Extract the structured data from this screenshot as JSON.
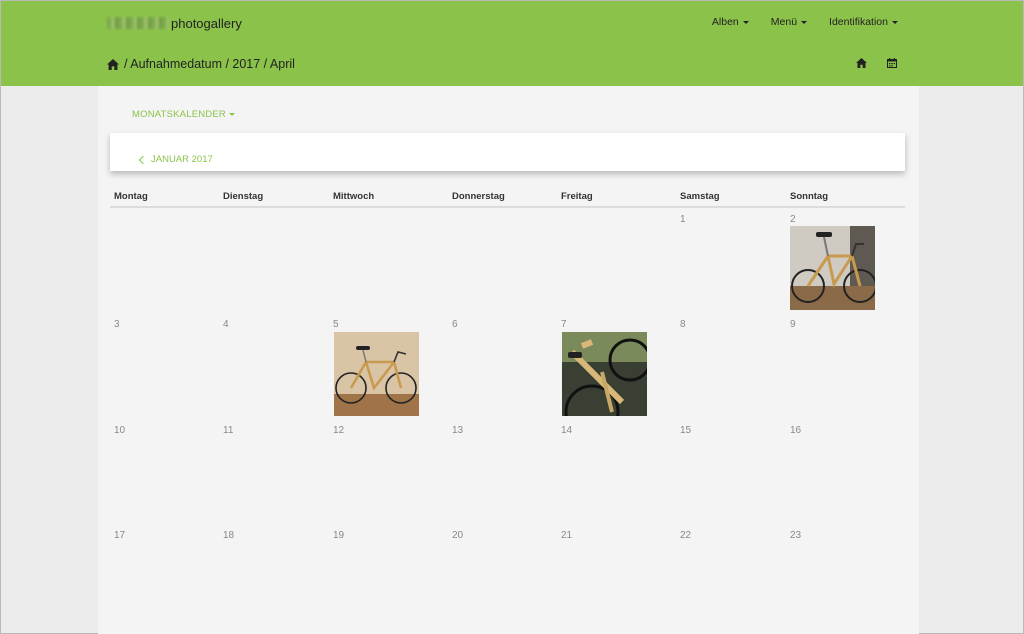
{
  "brand": {
    "name": "photogallery"
  },
  "nav": {
    "items": [
      {
        "label": "Alben"
      },
      {
        "label": "Menü"
      },
      {
        "label": "Identifikation"
      }
    ]
  },
  "breadcrumb": {
    "text": "/ Aufnahmedatum / 2017 / April"
  },
  "toolbar": {
    "monats_label": "MONATSKALENDER",
    "prev_label": "JANUAR 2017"
  },
  "calendar": {
    "weekdays": [
      "Montag",
      "Dienstag",
      "Mittwoch",
      "Donnerstag",
      "Freitag",
      "Samstag",
      "Sonntag"
    ],
    "weeks": [
      [
        "",
        "",
        "",
        "",
        "",
        "1",
        "2"
      ],
      [
        "3",
        "4",
        "5",
        "6",
        "7",
        "8",
        "9"
      ],
      [
        "10",
        "11",
        "12",
        "13",
        "14",
        "15",
        "16"
      ],
      [
        "17",
        "18",
        "19",
        "20",
        "21",
        "22",
        "23"
      ]
    ],
    "photos": [
      {
        "day": "2",
        "subject": "bicycle-photo"
      },
      {
        "day": "5",
        "subject": "bicycle-photo"
      },
      {
        "day": "7",
        "subject": "bicycle-photo"
      }
    ]
  },
  "colors": {
    "accent": "#8bc34a",
    "background": "#f4f4f4"
  },
  "icons": {
    "home": "home-icon",
    "calendar": "calendar-icon",
    "chevron_left": "chevron-left-icon"
  }
}
